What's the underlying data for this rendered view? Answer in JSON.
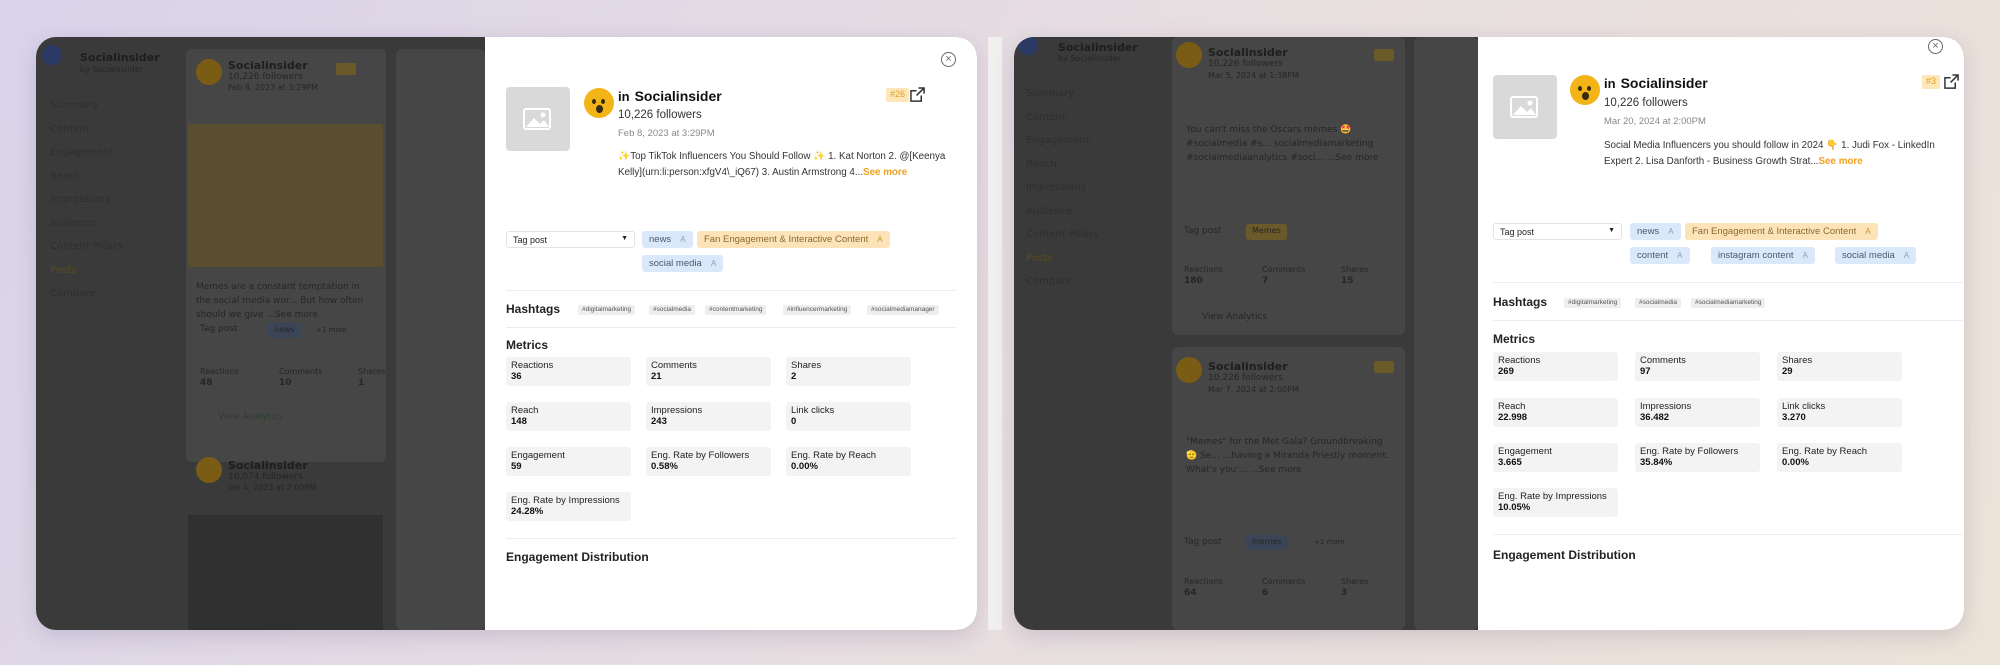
{
  "left_view": {
    "background": {
      "logo_text": "Socialinsider",
      "logo_sub": "by Socialinsider",
      "nav_items": [
        "Summary",
        "Content",
        "Engagement",
        "Reach",
        "Impressions",
        "Audience",
        "Content Pillars",
        "Posts",
        "Compare"
      ],
      "cards": [
        {
          "account": "Socialinsider",
          "followers": "10,226 followers",
          "date": "Feb 8, 2023 at 3:29PM",
          "caption": "Memes are a constant temptation in the social media wor... But how often should we give ...See more",
          "tag_select": "Tag post",
          "tag_chip": "news",
          "more": "+1 more",
          "metrics": [
            {
              "label": "Reactions",
              "value": "48"
            },
            {
              "label": "Comments",
              "value": "10"
            },
            {
              "label": "Shares",
              "value": "1"
            }
          ],
          "link": "View Analytics"
        },
        {
          "account": "Socialinsider",
          "followers": "10,074 followers",
          "date": "Jan 4, 2023 at 2:00PM"
        }
      ]
    },
    "panel": {
      "account_name": "Socialinsider",
      "followers": "10,226 followers",
      "date": "Feb 8, 2023 at 3:29PM",
      "caption": "✨Top TikTok Influencers You Should Follow ✨ 1. Kat Norton 2. @[Keenya Kelly](urn:li:person:xfgV4\\_iQ67) 3. Austin Armstrong 4...",
      "see_more": "See more",
      "rank": "#26",
      "tag_select_label": "Tag post",
      "tags": [
        {
          "label": "news",
          "style": "blue"
        },
        {
          "label": "Fan Engagement & Interactive Content",
          "style": "orange"
        },
        {
          "label": "social media",
          "style": "blue"
        }
      ],
      "hashtags_title": "Hashtags",
      "hashtags": [
        "#digitalmarketing",
        "#socialmedia",
        "#contentmarketing",
        "#influencermarketing",
        "#socialmediamanager"
      ],
      "metrics_title": "Metrics",
      "metrics": [
        {
          "label": "Reactions",
          "value": "36"
        },
        {
          "label": "Comments",
          "value": "21"
        },
        {
          "label": "Shares",
          "value": "2"
        },
        {
          "label": "Reach",
          "value": "148"
        },
        {
          "label": "Impressions",
          "value": "243"
        },
        {
          "label": "Link clicks",
          "value": "0"
        },
        {
          "label": "Engagement",
          "value": "59"
        },
        {
          "label": "Eng. Rate by Followers",
          "value": "0.58%"
        },
        {
          "label": "Eng. Rate by Reach",
          "value": "0.00%"
        },
        {
          "label": "Eng. Rate by Impressions",
          "value": "24.28%"
        }
      ],
      "distribution_title": "Engagement Distribution"
    }
  },
  "right_view": {
    "background": {
      "logo_text": "Socialinsider",
      "logo_sub": "by Socialinsider",
      "nav_items": [
        "Summary",
        "Content",
        "Engagement",
        "Reach",
        "Impressions",
        "Audience",
        "Content Pillars",
        "Posts",
        "Compare"
      ],
      "cards": [
        {
          "account": "Socialinsider",
          "followers": "10,226 followers",
          "date": "Mar 5, 2024 at 1:38PM",
          "caption": "You can't miss the Oscars memes 🤩 #socialmedia #s... socialmediamarketing #socialmediaanalytics #soci... ...See more",
          "tag_select": "Tag post",
          "tag_chip": "Memes",
          "metrics": [
            {
              "label": "Reactions",
              "value": "180"
            },
            {
              "label": "Comments",
              "value": "7"
            },
            {
              "label": "Shares",
              "value": "15"
            }
          ],
          "link": "View Analytics"
        },
        {
          "account": "Socialinsider",
          "followers": "10,226 followers",
          "date": "Mar 7, 2024 at 2:00PM",
          "caption": "\"Memes\" for the Met Gala? Groundbreaking 🫡 Se... ...having a Miranda Priestly moment. What's you'... ...See more",
          "tag_select": "Tag post",
          "tag_chip": "memes",
          "more": "+1 more",
          "metrics": [
            {
              "label": "Reactions",
              "value": "64"
            },
            {
              "label": "Comments",
              "value": "6"
            },
            {
              "label": "Shares",
              "value": "3"
            }
          ]
        }
      ]
    },
    "panel": {
      "account_name": "Socialinsider",
      "followers": "10,226 followers",
      "date": "Mar 20, 2024 at 2:00PM",
      "caption": "Social Media Influencers you should follow in 2024 👇 1. Judi Fox - LinkedIn Expert 2. Lisa Danforth - Business Growth Strat...",
      "see_more": "See more",
      "rank": "#3",
      "tag_select_label": "Tag post",
      "tags": [
        {
          "label": "news",
          "style": "blue"
        },
        {
          "label": "Fan Engagement & Interactive Content",
          "style": "orange"
        },
        {
          "label": "content",
          "style": "blue"
        },
        {
          "label": "instagram content",
          "style": "blue"
        },
        {
          "label": "social media",
          "style": "blue"
        }
      ],
      "hashtags_title": "Hashtags",
      "hashtags": [
        "#digitalmarketing",
        "#socialmedia",
        "#socialmediamarketing"
      ],
      "metrics_title": "Metrics",
      "metrics": [
        {
          "label": "Reactions",
          "value": "269"
        },
        {
          "label": "Comments",
          "value": "97"
        },
        {
          "label": "Shares",
          "value": "29"
        },
        {
          "label": "Reach",
          "value": "22.998"
        },
        {
          "label": "Impressions",
          "value": "36.482"
        },
        {
          "label": "Link clicks",
          "value": "3.270"
        },
        {
          "label": "Engagement",
          "value": "3.665"
        },
        {
          "label": "Eng. Rate by Followers",
          "value": "35.84%"
        },
        {
          "label": "Eng. Rate by Reach",
          "value": "0.00%"
        },
        {
          "label": "Eng. Rate by Impressions",
          "value": "10.05%"
        }
      ],
      "distribution_title": "Engagement Distribution"
    }
  },
  "icons": {
    "close": "close-icon",
    "external_link": "external-link-icon",
    "image_placeholder": "image-placeholder-icon",
    "caret": "caret-down-icon",
    "tag_remove": "tag-remove-icon"
  },
  "colors": {
    "accent_orange": "#f0a020",
    "tag_blue": "#dbe8fa",
    "tag_orange": "#fde3b8",
    "overlay": "#3a3a3a"
  }
}
